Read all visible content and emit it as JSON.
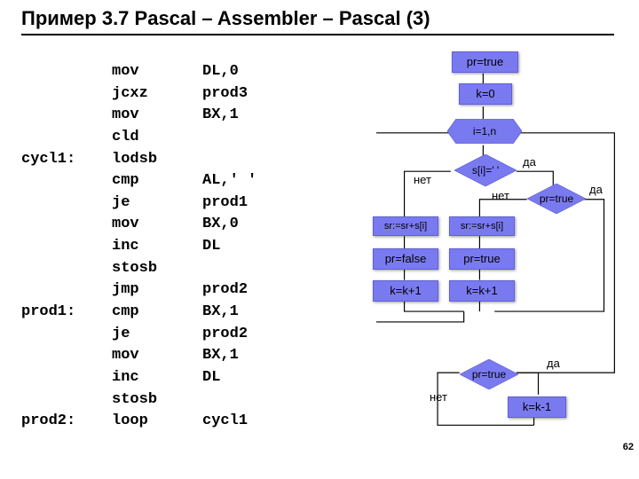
{
  "title": "Пример 3.7 Pascal – Assembler – Pascal (3)",
  "code": "          mov       DL,0\n          jcxz      prod3\n          mov       BX,1\n          cld\ncycl1:    lodsb\n          cmp       AL,' '\n          je        prod1\n          mov       BX,0\n          inc       DL\n          stosb\n          jmp       prod2\nprod1:    cmp       BX,1\n          je        prod2\n          mov       BX,1\n          inc       DL\n          stosb\nprod2:    loop      cycl1",
  "flow": {
    "pr_true_top": "pr=true",
    "k0": "k=0",
    "loop": "i=1,n",
    "cond_space": "s[i]=' '",
    "cond_pr": "pr=true",
    "sr_left": "sr:=sr+s[i]",
    "sr_right": "sr:=sr+s[i]",
    "pr_false": "pr=false",
    "pr_true_r": "pr=true",
    "k_inc_l": "k=k+1",
    "k_inc_r": "k=k+1",
    "cond_pr2": "pr=true",
    "k_dec": "k=k-1"
  },
  "labels": {
    "yes": "да",
    "no": "нет"
  },
  "page": "62"
}
